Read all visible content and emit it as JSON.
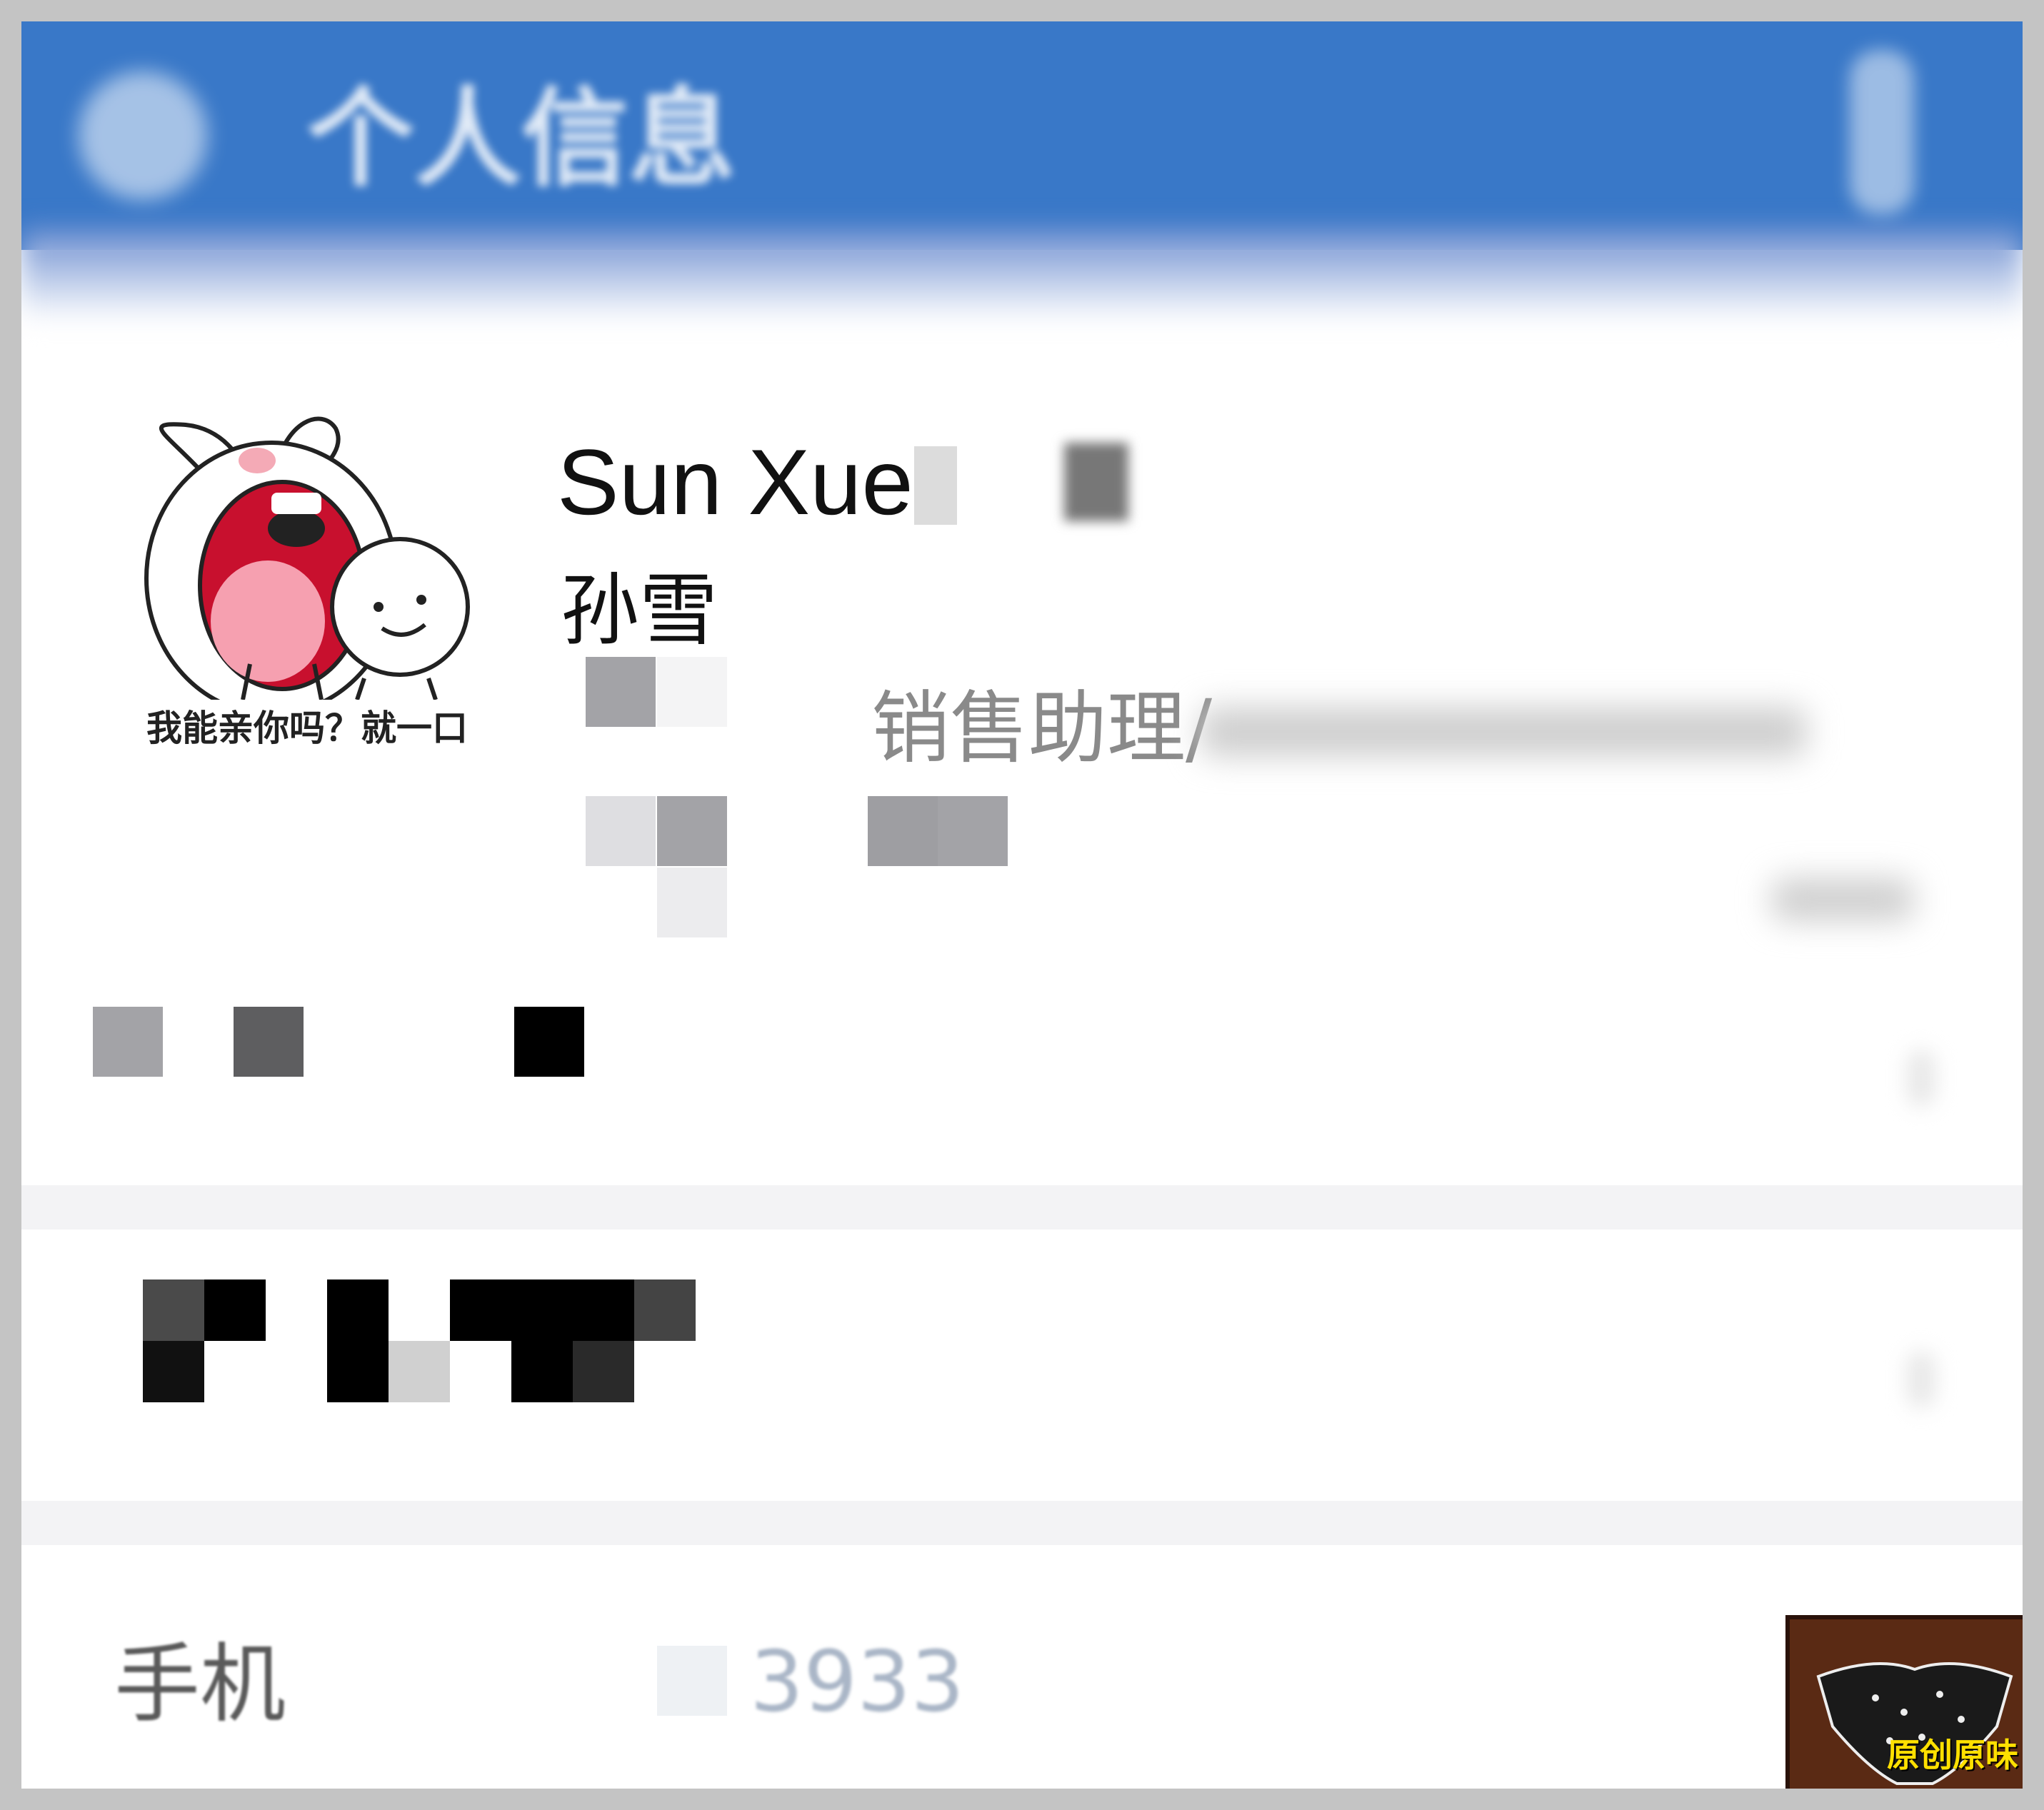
{
  "header": {
    "title": "个人信息"
  },
  "profile": {
    "avatar_caption": "我能亲你吗？就一口",
    "name_en": "Sun Xue",
    "name_cn": "孙雪",
    "job_title": "销售助理/"
  },
  "contact": {
    "phone_label": "手机",
    "phone_value": "3933"
  },
  "watermark": {
    "text": "原创原味"
  },
  "colors": {
    "header_bg": "#3978c8",
    "text_gray": "#8a8a8a"
  }
}
